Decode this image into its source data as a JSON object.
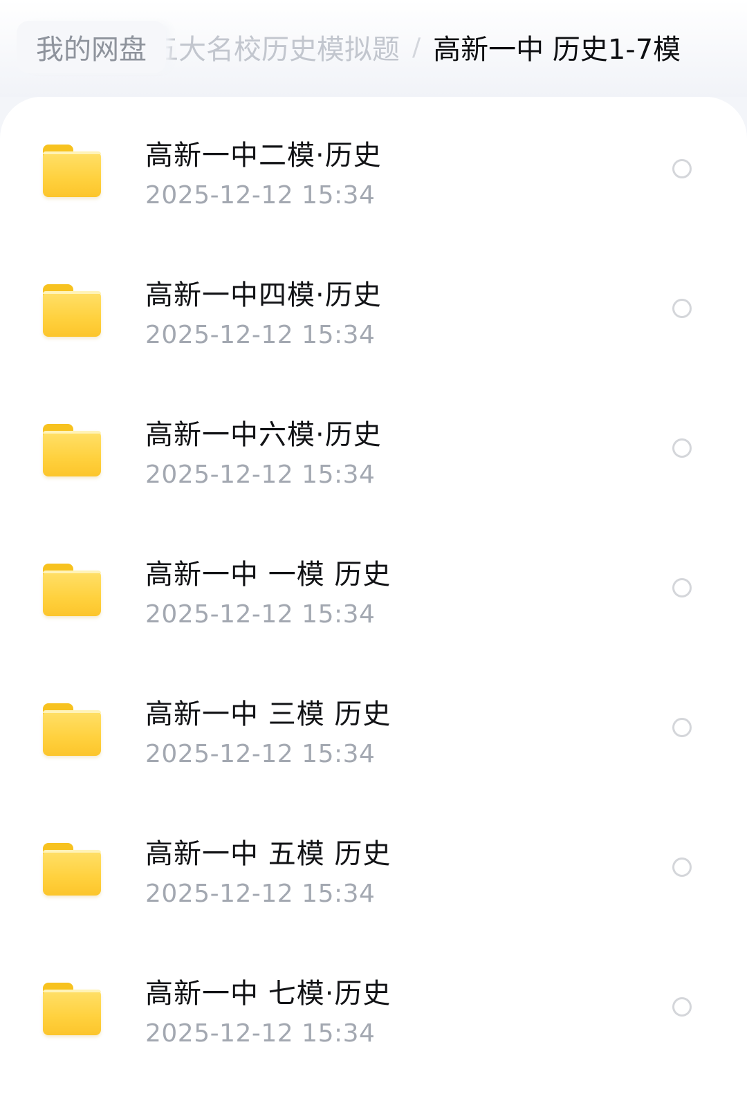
{
  "breadcrumb": {
    "home": "我的网盘",
    "parent": "五大名校历史模拟题",
    "separator": "/",
    "current": "高新一中 历史1-7模"
  },
  "folder_color": "#FFD13E",
  "items": [
    {
      "name": "高新一中二模·历史",
      "date": "2025-12-12  15:34",
      "icon": "folder-icon"
    },
    {
      "name": "高新一中四模·历史",
      "date": "2025-12-12  15:34",
      "icon": "folder-icon"
    },
    {
      "name": "高新一中六模·历史",
      "date": "2025-12-12  15:34",
      "icon": "folder-icon"
    },
    {
      "name": "高新一中 一模 历史",
      "date": "2025-12-12  15:34",
      "icon": "folder-icon"
    },
    {
      "name": "高新一中 三模 历史",
      "date": "2025-12-12  15:34",
      "icon": "folder-icon"
    },
    {
      "name": "高新一中 五模 历史",
      "date": "2025-12-12  15:34",
      "icon": "folder-icon"
    },
    {
      "name": "高新一中 七模·历史",
      "date": "2025-12-12  15:34",
      "icon": "folder-icon"
    }
  ]
}
